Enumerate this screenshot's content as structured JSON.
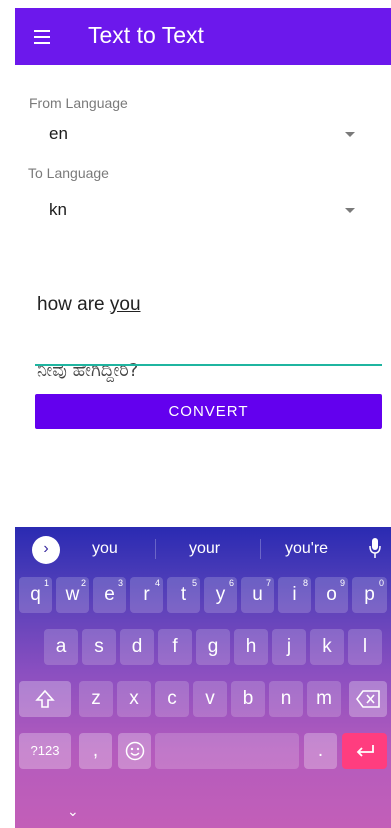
{
  "app": {
    "title": "Text to Text"
  },
  "from": {
    "label": "From Language",
    "value": "en"
  },
  "to": {
    "label": "To Language",
    "value": "kn"
  },
  "input": {
    "text_start": "how are ",
    "text_underlined": "you"
  },
  "output": {
    "text": "ನೀವು ಹೇಗಿದ್ದೀರಿ?"
  },
  "convert": {
    "label": "CONVERT"
  },
  "keyboard": {
    "suggestions": [
      "you",
      "your",
      "you're"
    ],
    "row1": [
      {
        "k": "q",
        "n": "1"
      },
      {
        "k": "w",
        "n": "2"
      },
      {
        "k": "e",
        "n": "3"
      },
      {
        "k": "r",
        "n": "4"
      },
      {
        "k": "t",
        "n": "5"
      },
      {
        "k": "y",
        "n": "6"
      },
      {
        "k": "u",
        "n": "7"
      },
      {
        "k": "i",
        "n": "8"
      },
      {
        "k": "o",
        "n": "9"
      },
      {
        "k": "p",
        "n": "0"
      }
    ],
    "row2": [
      "a",
      "s",
      "d",
      "f",
      "g",
      "h",
      "j",
      "k",
      "l"
    ],
    "row3": [
      "z",
      "x",
      "c",
      "v",
      "b",
      "n",
      "m"
    ],
    "symbols_label": "?123",
    "comma": ",",
    "period": ".",
    "hide": "⌄"
  },
  "colors": {
    "appbar": "#6c18ec",
    "button": "#6300ee",
    "underline": "#1fb5a0",
    "enter": "#ff3d7f"
  },
  "icons": {
    "menu": "hamburger-icon",
    "suggest": "chevron-right-icon",
    "mic": "mic-icon",
    "shift": "shift-icon",
    "backspace": "backspace-icon",
    "emoji": "emoji-icon",
    "enter": "enter-icon"
  }
}
